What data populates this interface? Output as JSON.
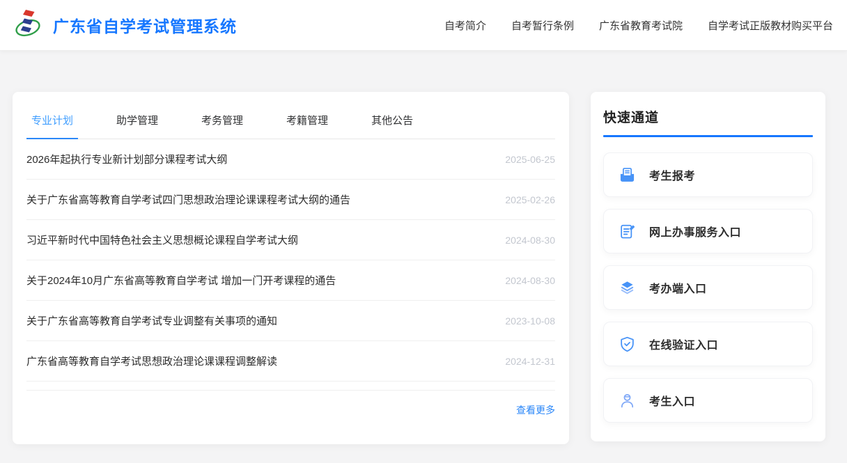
{
  "colors": {
    "brand_blue": "#1677ff",
    "tab_active_blue": "#409eff",
    "link_blue": "#2b87f8",
    "icon_blue": "#4793f7",
    "date_gray": "#c3c7cf",
    "page_bg": "#f4f4f5"
  },
  "header": {
    "title": "广东省自学考试管理系统",
    "logo": "exam-system-emblem",
    "nav": [
      {
        "label": "自考简介"
      },
      {
        "label": "自考暂行条例"
      },
      {
        "label": "广东省教育考试院"
      },
      {
        "label": "自学考试正版教材购买平台"
      }
    ]
  },
  "tabs": [
    {
      "label": "专业计划",
      "active": true
    },
    {
      "label": "助学管理",
      "active": false
    },
    {
      "label": "考务管理",
      "active": false
    },
    {
      "label": "考籍管理",
      "active": false
    },
    {
      "label": "其他公告",
      "active": false
    }
  ],
  "news": [
    {
      "title": "2026年起执行专业新计划部分课程考试大纲",
      "date": "2025-06-25"
    },
    {
      "title": "关于广东省高等教育自学考试四门思想政治理论课课程考试大纲的通告",
      "date": "2025-02-26"
    },
    {
      "title": "习近平新时代中国特色社会主义思想概论课程自学考试大纲",
      "date": "2024-08-30"
    },
    {
      "title": "关于2024年10月广东省高等教育自学考试 增加一门开考课程的通告",
      "date": "2024-08-30"
    },
    {
      "title": "关于广东省高等教育自学考试专业调整有关事项的通知",
      "date": "2023-10-08"
    },
    {
      "title": "广东省高等教育自学考试思想政治理论课课程调整解读",
      "date": "2024-12-31"
    }
  ],
  "more_link": "查看更多",
  "quick_panel": {
    "title": "快速通道",
    "items": [
      {
        "label": "考生报考",
        "icon": "inbox-icon"
      },
      {
        "label": "网上办事服务入口",
        "icon": "edit-document-icon"
      },
      {
        "label": "考办端入口",
        "icon": "layers-icon"
      },
      {
        "label": "在线验证入口",
        "icon": "shield-check-icon"
      },
      {
        "label": "考生入口",
        "icon": "user-icon"
      }
    ]
  }
}
